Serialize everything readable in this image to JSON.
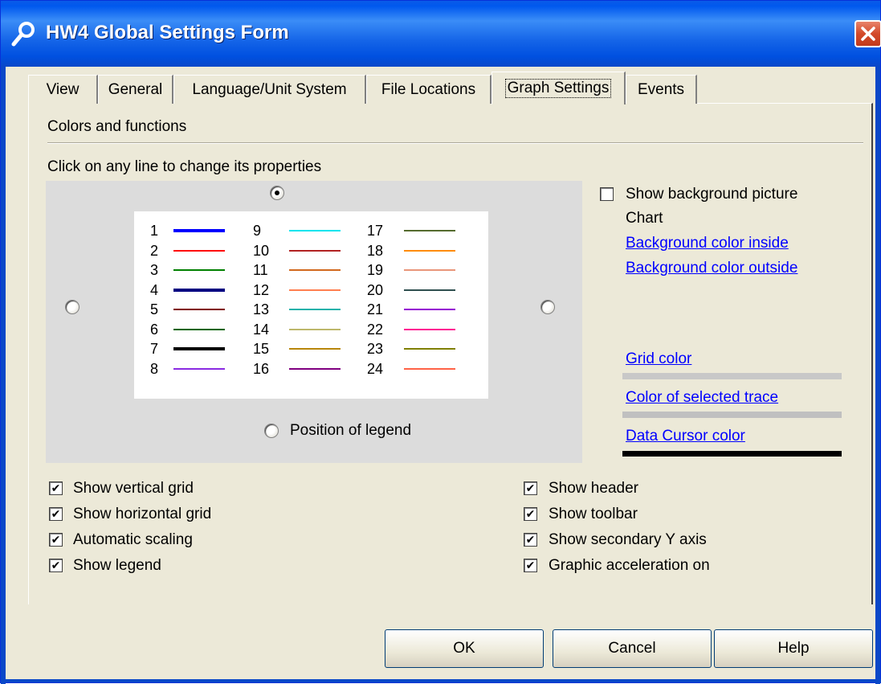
{
  "window": {
    "title": "HW4 Global Settings Form"
  },
  "tabs": [
    {
      "label": "View"
    },
    {
      "label": "General"
    },
    {
      "label": "Language/Unit System"
    },
    {
      "label": "File Locations"
    },
    {
      "label": "Graph Settings",
      "active": true
    },
    {
      "label": "Events"
    }
  ],
  "panel": {
    "section_label": "Colors and functions",
    "hint": "Click on any line to change its properties",
    "legend_position_label": "Position of legend",
    "legend_position_selected": "top",
    "legend_entries": [
      {
        "n": "1",
        "color": "#0000ff",
        "thick": true
      },
      {
        "n": "2",
        "color": "#ff0000"
      },
      {
        "n": "3",
        "color": "#008000"
      },
      {
        "n": "4",
        "color": "#000080",
        "thick": true
      },
      {
        "n": "5",
        "color": "#800000"
      },
      {
        "n": "6",
        "color": "#006400"
      },
      {
        "n": "7",
        "color": "#000000",
        "thick": true
      },
      {
        "n": "8",
        "color": "#8a2be2"
      },
      {
        "n": "9",
        "color": "#00e5ee"
      },
      {
        "n": "10",
        "color": "#b22222"
      },
      {
        "n": "11",
        "color": "#d2691e"
      },
      {
        "n": "12",
        "color": "#ff7f50"
      },
      {
        "n": "13",
        "color": "#20b2aa"
      },
      {
        "n": "14",
        "color": "#bdb76b"
      },
      {
        "n": "15",
        "color": "#b8860b"
      },
      {
        "n": "16",
        "color": "#800080"
      },
      {
        "n": "17",
        "color": "#556b2f"
      },
      {
        "n": "18",
        "color": "#ff8c00"
      },
      {
        "n": "19",
        "color": "#e9967a"
      },
      {
        "n": "20",
        "color": "#2f4f4f"
      },
      {
        "n": "21",
        "color": "#9400d3"
      },
      {
        "n": "22",
        "color": "#ff1493"
      },
      {
        "n": "23",
        "color": "#808000"
      },
      {
        "n": "24",
        "color": "#ff6347"
      }
    ],
    "show_background_picture": {
      "label": "Show background picture",
      "checked": false
    },
    "chart_label": "Chart",
    "links": {
      "bg_inside": "Background color inside",
      "bg_outside": "Background color outside",
      "grid_color": "Grid color",
      "selected_trace": "Color of selected trace",
      "data_cursor": "Data Cursor color"
    },
    "colors": {
      "grid": "#c8c8c8",
      "selected_trace": "#c0c0c0",
      "data_cursor": "#000000"
    },
    "options_left": [
      {
        "label": "Show vertical grid",
        "checked": true
      },
      {
        "label": "Show horizontal grid",
        "checked": true
      },
      {
        "label": "Automatic scaling",
        "checked": true
      },
      {
        "label": "Show legend",
        "checked": true
      }
    ],
    "options_right": [
      {
        "label": "Show header",
        "checked": true
      },
      {
        "label": "Show toolbar",
        "checked": true
      },
      {
        "label": "Show secondary Y axis",
        "checked": true
      },
      {
        "label": "Graphic acceleration on",
        "checked": true
      }
    ],
    "check_mark": "✔"
  },
  "buttons": {
    "ok": "OK",
    "cancel": "Cancel",
    "help": "Help"
  }
}
